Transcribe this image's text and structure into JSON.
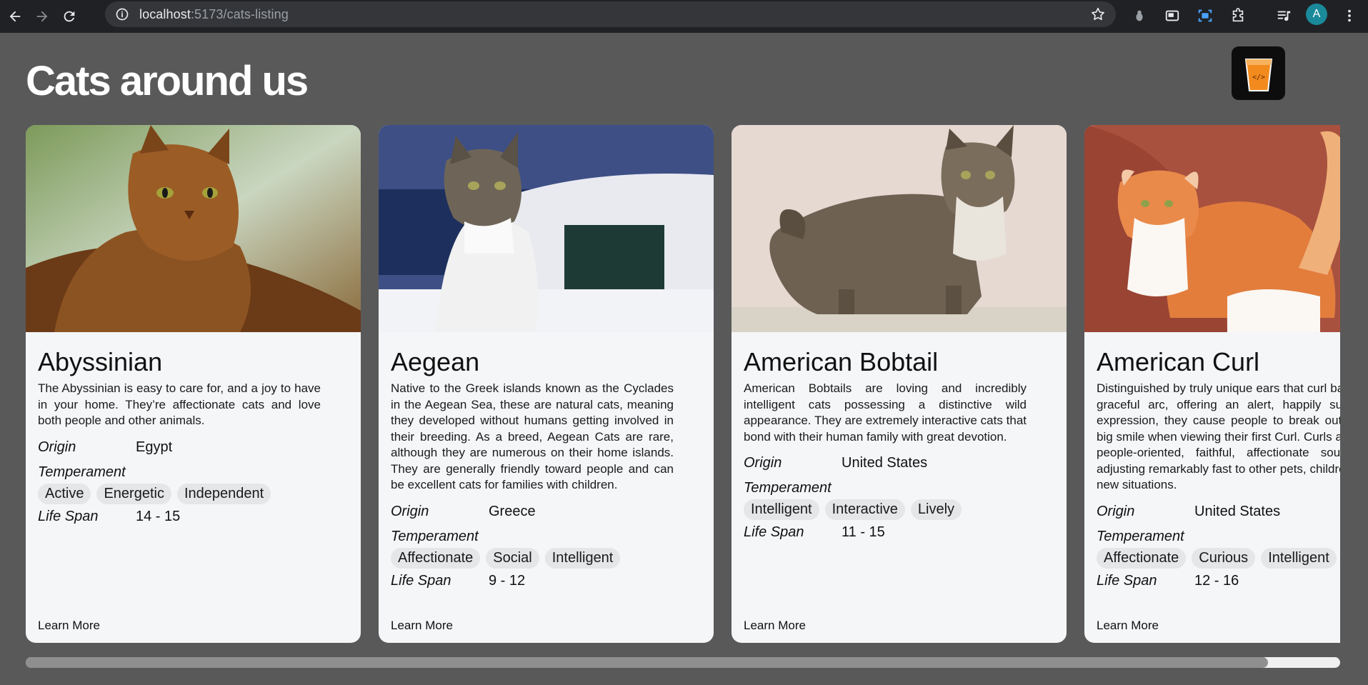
{
  "browser": {
    "url_host": "localhost",
    "url_path": ":5173/cats-listing",
    "avatar_letter": "A"
  },
  "page": {
    "title": "Cats around us",
    "learn_more_label": "Learn More",
    "origin_label": "Origin",
    "temperament_label": "Temperament",
    "life_span_label": "Life Span",
    "scroll_fraction": 0.945
  },
  "cats": [
    {
      "name": "Abyssinian",
      "description": "The Abyssinian is easy to care for, and a joy to have in your home. They’re affectionate cats and love both people and other animals.",
      "origin": "Egypt",
      "temperament": [
        "Active",
        "Energetic",
        "Independent"
      ],
      "life_span": "14 - 15"
    },
    {
      "name": "Aegean",
      "description": "Native to the Greek islands known as the Cyclades in the Aegean Sea, these are natural cats, meaning they developed without humans getting involved in their breeding. As a breed, Aegean Cats are rare, although they are numerous on their home islands. They are generally friendly toward people and can be excellent cats for families with children.",
      "origin": "Greece",
      "temperament": [
        "Affectionate",
        "Social",
        "Intelligent"
      ],
      "life_span": "9 - 12"
    },
    {
      "name": "American Bobtail",
      "description": "American Bobtails are loving and incredibly intelligent cats possessing a distinctive wild appearance. They are extremely interactive cats that bond with their human family with great devotion.",
      "origin": "United States",
      "temperament": [
        "Intelligent",
        "Interactive",
        "Lively"
      ],
      "life_span": "11 - 15"
    },
    {
      "name": "American Curl",
      "description": "Distinguished by truly unique ears that curl back in a graceful arc, offering an alert, happily surprised expression, they cause people to break out into a big smile when viewing their first Curl. Curls are very people-oriented, faithful, affectionate soulmates, adjusting remarkably fast to other pets, children, and new situations.",
      "origin": "United States",
      "temperament": [
        "Affectionate",
        "Curious",
        "Intelligent"
      ],
      "life_span": "12 - 16"
    }
  ]
}
